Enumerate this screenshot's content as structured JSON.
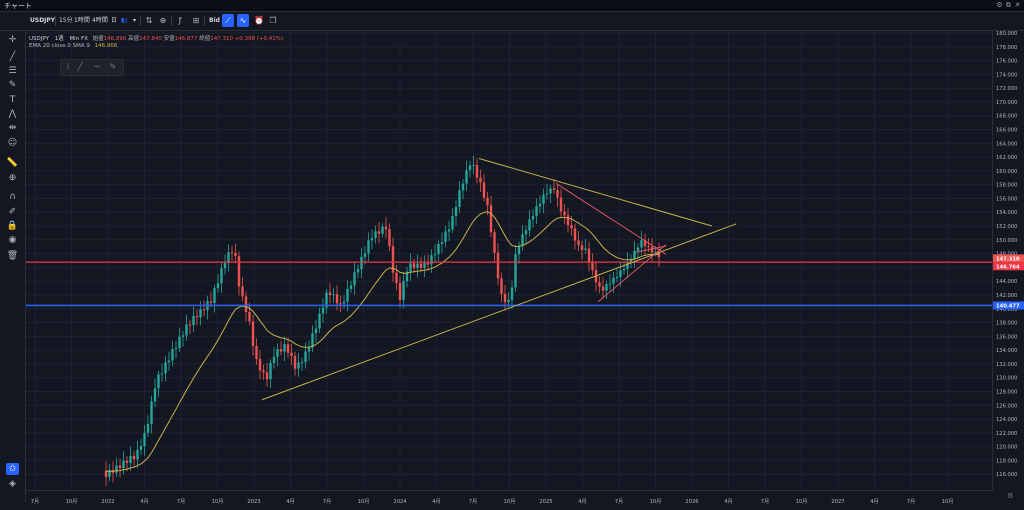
{
  "window": {
    "title": "チャート"
  },
  "toolbar": {
    "symbol": "USDJPY",
    "intervals": [
      "15分",
      "1時間",
      "4時間",
      "日"
    ],
    "price_type": "Bid"
  },
  "legend": {
    "symbol": "USDJPY",
    "interval": "1週",
    "source": "Min FX",
    "open_label": "始値",
    "open_value": "146.890",
    "high_label": "高値",
    "high_value": "147.840",
    "low_label": "安値",
    "low_value": "146.877",
    "close_label": "終値",
    "close_value": "147.310",
    "change": "+0.398 (+0.41%)",
    "ema_label": "EMA 20 close 0 SMA 9",
    "ema_value": "146.966"
  },
  "price_axis": {
    "min": 114,
    "max": 180,
    "labels": [
      "180.000",
      "178.000",
      "176.000",
      "174.000",
      "172.000",
      "170.000",
      "168.000",
      "166.000",
      "164.000",
      "162.000",
      "160.000",
      "158.000",
      "156.000",
      "154.000",
      "152.000",
      "150.000",
      "148.000",
      "146.000",
      "144.000",
      "142.000",
      "140.000",
      "138.000",
      "136.000",
      "134.000",
      "132.000",
      "130.000",
      "128.000",
      "126.000",
      "124.000",
      "122.000",
      "120.000",
      "118.000",
      "116.000"
    ],
    "current_price": "147.310",
    "current_value": 147.31,
    "red_line_label": "146.764",
    "red_line_value": 146.764,
    "blue_line_label": "140.477",
    "blue_line_value": 140.477
  },
  "time_axis": {
    "labels": [
      "7月",
      "10月",
      "2022",
      "4月",
      "7月",
      "10月",
      "2023",
      "4月",
      "7月",
      "10月",
      "2024",
      "4月",
      "7月",
      "10月",
      "2025",
      "4月",
      "7月",
      "10月",
      "2026",
      "4月",
      "7月",
      "10月",
      "2027",
      "4月",
      "7月",
      "10月"
    ]
  },
  "colors": {
    "background": "#131722",
    "up": "#26a69a",
    "down": "#ef5350",
    "accent": "#2962ff",
    "ema": "#c8b04a",
    "red_line": "#f23645",
    "blue_line": "#2962ff"
  },
  "icons": {
    "toolbar": [
      "compare-icon",
      "add-indicator-icon",
      "indicators-icon",
      "templates-icon",
      "line-chart-icon",
      "area-chart-icon",
      "alert-icon",
      "snapshot-icon"
    ],
    "left": [
      "crosshair-icon",
      "trendline-icon",
      "fib-icon",
      "brush-icon",
      "text-icon",
      "pattern-icon",
      "prediction-icon",
      "emoji-icon",
      "ruler-icon",
      "zoom-icon",
      "magnet-icon",
      "lock-drawing-icon",
      "lock-icon",
      "eye-icon",
      "trash-icon",
      "favorites-icon",
      "layers-icon"
    ]
  }
}
